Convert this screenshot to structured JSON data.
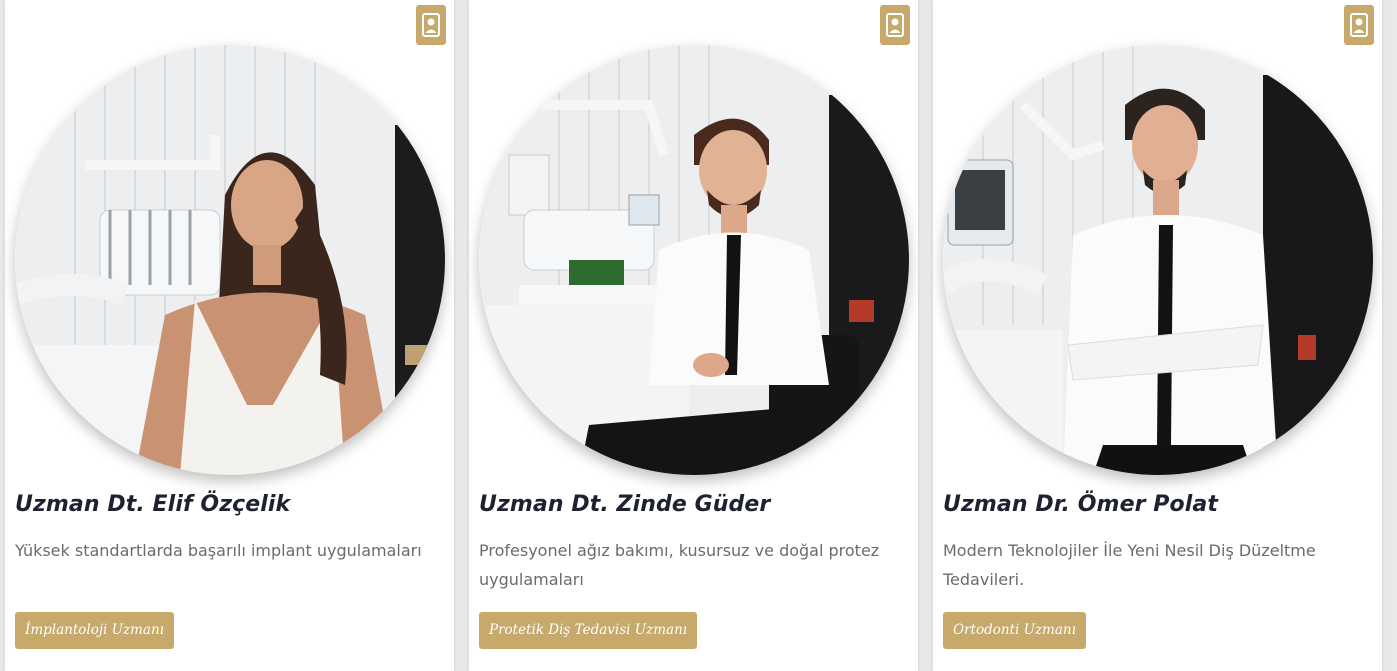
{
  "colors": {
    "accent": "#c6a96b",
    "name_text": "#1e2130",
    "description_text": "#6b6b6b",
    "card_background": "#ffffff",
    "page_background": "#e9e9ea"
  },
  "card_icon": "id-badge-icon",
  "specialists": [
    {
      "name": "Uzman Dt. Elif Özçelik",
      "description": "Yüksek standartlarda başarılı implant uygulamaları",
      "specialty": "İmplantoloji Uzmanı"
    },
    {
      "name": "Uzman Dt. Zinde Güder",
      "description": "Profesyonel ağız bakımı, kusursuz ve doğal protez uygulamaları",
      "specialty": "Protetik Diş Tedavisi Uzmanı"
    },
    {
      "name": "Uzman Dr. Ömer Polat",
      "description": "Modern Teknolojiler İle Yeni Nesil Diş Düzeltme Tedavileri.",
      "specialty": "Ortodonti Uzmanı"
    }
  ]
}
